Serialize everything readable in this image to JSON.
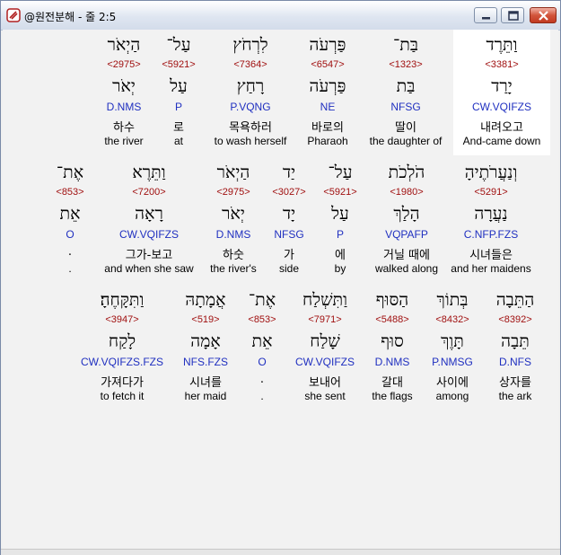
{
  "window": {
    "title": "@원전분해 - 줄 2:5"
  },
  "colors": {
    "strong": "#a01010",
    "morph": "#2030c0",
    "highlight": "#ffffff"
  },
  "rows": [
    [
      {
        "h1": "וַתֵּרֶד",
        "strong": "<3381>",
        "h2": "יָרַד",
        "morph": "CW.VQIFZS",
        "ko": "내려오고",
        "en": "And-came down"
      },
      {
        "h1": "בַּת־",
        "strong": "<1323>",
        "h2": "בַּת",
        "morph": "NFSG",
        "ko": "딸이",
        "en": "the daughter of"
      },
      {
        "h1": "פַּרְעֹה",
        "strong": "<6547>",
        "h2": "פַּרְעֹה",
        "morph": "NE",
        "ko": "바로의",
        "en": "Pharaoh"
      },
      {
        "h1": "לִרְחֹץ",
        "strong": "<7364>",
        "h2": "רָחַץ",
        "morph": "P.VQNG",
        "ko": "목욕하러",
        "en": "to wash herself"
      },
      {
        "h1": "עַל־",
        "strong": "<5921>",
        "h2": "עַל",
        "morph": "P",
        "ko": "로",
        "en": "at"
      },
      {
        "h1": "הַיְאֹר",
        "strong": "<2975>",
        "h2": "יְאֹר",
        "morph": "D.NMS",
        "ko": "하수",
        "en": "the river"
      }
    ],
    [
      {
        "h1": "וְנַעֲרֹתֶיהָ",
        "strong": "<5291>",
        "h2": "נַעֲרָה",
        "morph": "C.NFP.FZS",
        "ko": "시녀들은",
        "en": "and her maidens"
      },
      {
        "h1": "הֹלְכֹת",
        "strong": "<1980>",
        "h2": "הָלַךְ",
        "morph": "VQPAFP",
        "ko": "거닐 때에",
        "en": "walked along"
      },
      {
        "h1": "עַל־",
        "strong": "<5921>",
        "h2": "עַל",
        "morph": "P",
        "ko": "에",
        "en": "by"
      },
      {
        "h1": "יַד",
        "strong": "<3027>",
        "h2": "יָד",
        "morph": "NFSG",
        "ko": "가",
        "en": "side"
      },
      {
        "h1": "הַיְאֹר",
        "strong": "<2975>",
        "h2": "יְאֹר",
        "morph": "D.NMS",
        "ko": "하숫",
        "en": "the river's"
      },
      {
        "h1": "וַתֵּרֶא",
        "strong": "<7200>",
        "h2": "רָאָה",
        "morph": "CW.VQIFZS",
        "ko": "그가-보고",
        "en": "and when she saw"
      },
      {
        "h1": "אֶת־",
        "strong": "<853>",
        "h2": "אֵת",
        "morph": "O",
        "ko": ".",
        "en": "."
      }
    ],
    [
      {
        "h1": "הַתֵּבָה",
        "strong": "<8392>",
        "h2": "תֵּבָה",
        "morph": "D.NFS",
        "ko": "상자를",
        "en": "the ark"
      },
      {
        "h1": "בְּתוֹךְ",
        "strong": "<8432>",
        "h2": "תָּוֶךְ",
        "morph": "P.NMSG",
        "ko": "사이에",
        "en": "among"
      },
      {
        "h1": "הַסּוּף",
        "strong": "<5488>",
        "h2": "סוּף",
        "morph": "D.NMS",
        "ko": "갈대",
        "en": "the flags"
      },
      {
        "h1": "וַתִּשְׁלַח",
        "strong": "<7971>",
        "h2": "שָׁלַח",
        "morph": "CW.VQIFZS",
        "ko": "보내어",
        "en": "she sent"
      },
      {
        "h1": "אֶת־",
        "strong": "<853>",
        "h2": "אֵת",
        "morph": "O",
        "ko": ".",
        "en": "."
      },
      {
        "h1": "אֲמָתָהּ",
        "strong": "<519>",
        "h2": "אָמָה",
        "morph": "NFS.FZS",
        "ko": "시녀를",
        "en": "her maid"
      },
      {
        "h1": "וַתִּקָּחֶהָ׃",
        "strong": "<3947>",
        "h2": "לָקַח",
        "morph": "CW.VQIFZS.FZS",
        "ko": "가져다가",
        "en": "to fetch it"
      }
    ]
  ]
}
